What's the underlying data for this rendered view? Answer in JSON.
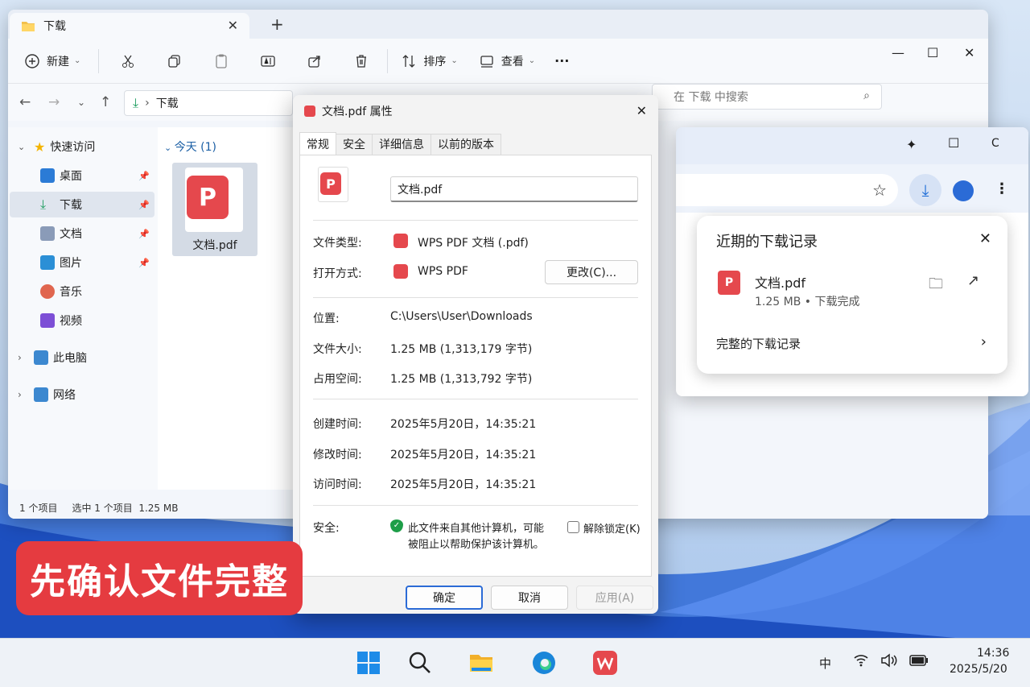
{
  "explorer": {
    "tab_title": "下载",
    "toolbar": {
      "new_label": "新建",
      "sort_label": "排序",
      "view_label": "查看",
      "more_label": "···"
    },
    "address": "下载",
    "search_placeholder": "在 下载 中搜索",
    "sidebar": [
      {
        "label": "快速访问",
        "icon": "star-icon",
        "color": "#f4b400"
      },
      {
        "label": "桌面",
        "icon": "desktop-icon",
        "color": "#2b7bd6",
        "pinned": true
      },
      {
        "label": "下载",
        "icon": "download-icon",
        "color": "#1e9e60",
        "pinned": true
      },
      {
        "label": "文档",
        "icon": "document-icon",
        "color": "#6b7fa3",
        "pinned": true
      },
      {
        "label": "图片",
        "icon": "picture-icon",
        "color": "#2b8fd6",
        "pinned": true
      },
      {
        "label": "音乐",
        "icon": "music-icon",
        "color": "#e0664f"
      },
      {
        "label": "视频",
        "icon": "video-icon",
        "color": "#7d4fd6"
      },
      {
        "label": "此电脑",
        "icon": "computer-icon",
        "color": "#3c88d0"
      },
      {
        "label": "网络",
        "icon": "network-icon",
        "color": "#3c88d0"
      }
    ],
    "group_header": "今天 (1)",
    "file_name": "文档.pdf",
    "status": {
      "count": "1 个项目",
      "selection": "选中 1 个项目  1.25 MB"
    }
  },
  "dialog": {
    "title": "文档.pdf 属性",
    "tabs": [
      "常规",
      "安全",
      "详细信息",
      "以前的版本"
    ],
    "file_name": "文档.pdf",
    "labels": {
      "type": "文件类型:",
      "open_with": "打开方式:",
      "location": "位置:",
      "size": "文件大小:",
      "size_on_disk": "占用空间:",
      "created": "创建时间:",
      "modified": "修改时间:",
      "accessed": "访问时间:",
      "security": "安全:"
    },
    "values": {
      "type": "WPS PDF 文档 (.pdf)",
      "open_with": "WPS PDF",
      "change_button": "更改(C)...",
      "location": "C:\\Users\\User\\Downloads",
      "size": "1.25 MB (1,313,179 字节)",
      "size_on_disk": "1.25 MB (1,313,792 字节)",
      "created": "2025年5月20日，14:35:21",
      "modified": "2025年5月20日，14:35:21",
      "accessed": "2025年5月20日，14:35:21",
      "security_line1": "此文件来自其他计算机，可能",
      "security_line2": "被阻止以帮助保护该计算机。",
      "unblock": "解除锁定(K)"
    },
    "buttons": {
      "ok": "确定",
      "cancel": "取消",
      "apply": "应用(A)"
    }
  },
  "browser": {
    "downloads": {
      "title": "近期的下载记录",
      "file_name": "文档.pdf",
      "file_meta": "1.25 MB • 下载完成",
      "full_history": "完整的下载记录"
    }
  },
  "banner": "先确认文件完整",
  "taskbar": {
    "ime": "中",
    "time": "14:36",
    "date": "2025/5/20"
  },
  "colors": {
    "accent": "#2b6bd6",
    "pdf_red": "#e5484d",
    "banner_red": "#e53b40"
  }
}
